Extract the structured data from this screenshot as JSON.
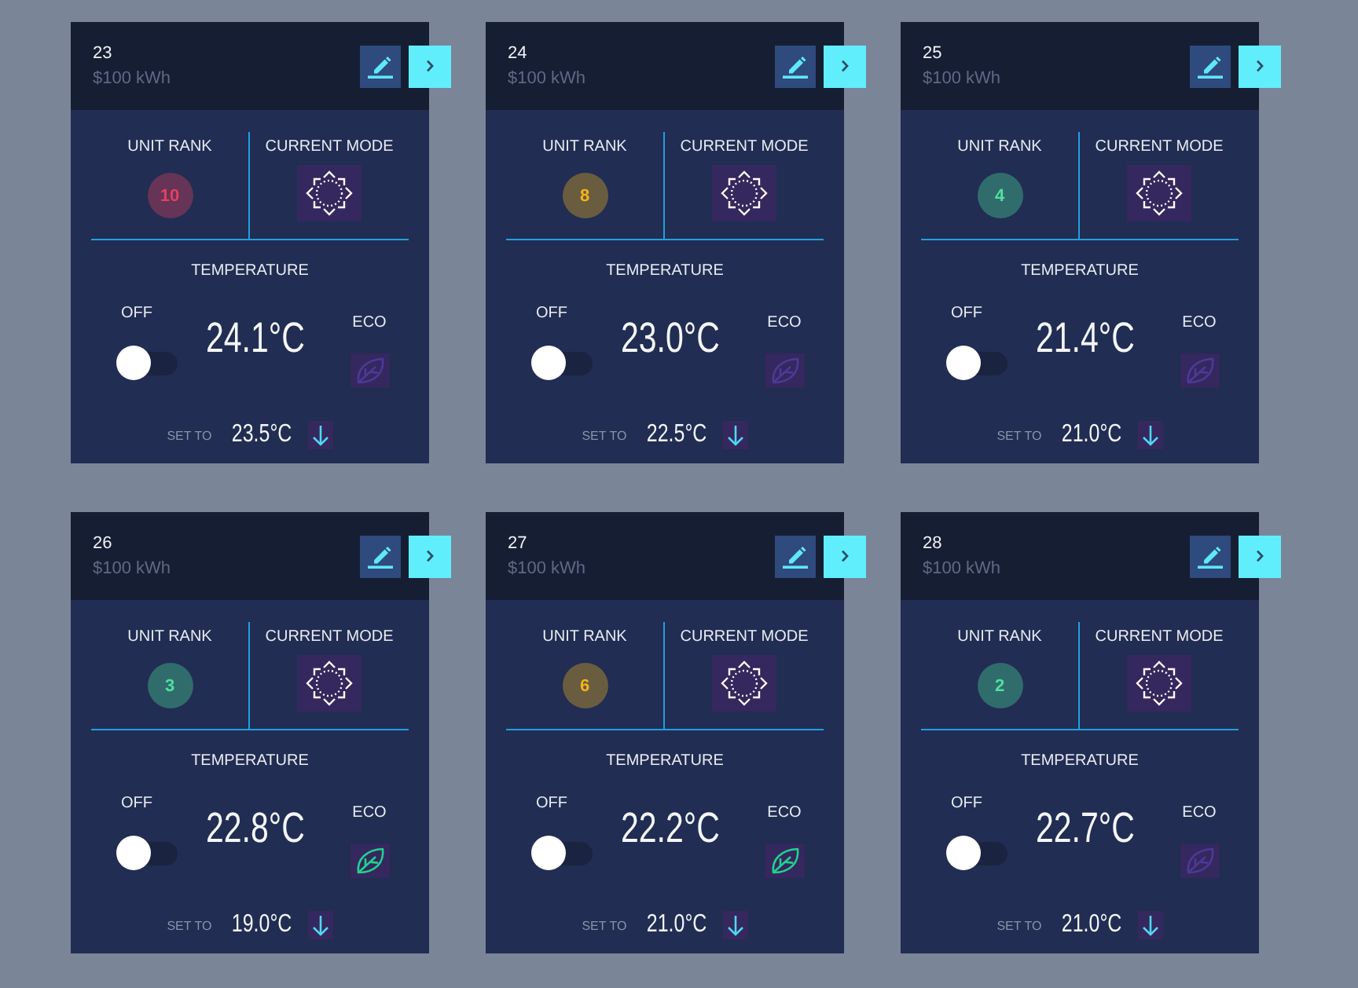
{
  "cards": [
    {
      "title": "23",
      "subtitle": "$100 kWh",
      "rank": {
        "label": "UNIT RANK",
        "value": "10",
        "color": "#e4405e"
      },
      "mode": {
        "label": "CURRENT MODE"
      },
      "temperature": {
        "label": "TEMPERATURE",
        "reading": "24.1°C"
      },
      "power": {
        "label": "OFF",
        "on": false
      },
      "eco": {
        "label": "ECO",
        "on": false
      },
      "setpoint": {
        "label": "SET TO",
        "value": "23.5°C"
      }
    },
    {
      "title": "24",
      "subtitle": "$100 kWh",
      "rank": {
        "label": "UNIT RANK",
        "value": "8",
        "color": "#f2b41c"
      },
      "mode": {
        "label": "CURRENT MODE"
      },
      "temperature": {
        "label": "TEMPERATURE",
        "reading": "23.0°C"
      },
      "power": {
        "label": "OFF",
        "on": false
      },
      "eco": {
        "label": "ECO",
        "on": false
      },
      "setpoint": {
        "label": "SET TO",
        "value": "22.5°C"
      }
    },
    {
      "title": "25",
      "subtitle": "$100 kWh",
      "rank": {
        "label": "UNIT RANK",
        "value": "4",
        "color": "#4fe0a0"
      },
      "mode": {
        "label": "CURRENT MODE"
      },
      "temperature": {
        "label": "TEMPERATURE",
        "reading": "21.4°C"
      },
      "power": {
        "label": "OFF",
        "on": false
      },
      "eco": {
        "label": "ECO",
        "on": false
      },
      "setpoint": {
        "label": "SET TO",
        "value": "21.0°C"
      }
    },
    {
      "title": "26",
      "subtitle": "$100 kWh",
      "rank": {
        "label": "UNIT RANK",
        "value": "3",
        "color": "#4fe0a0"
      },
      "mode": {
        "label": "CURRENT MODE"
      },
      "temperature": {
        "label": "TEMPERATURE",
        "reading": "22.8°C"
      },
      "power": {
        "label": "OFF",
        "on": false
      },
      "eco": {
        "label": "ECO",
        "on": true
      },
      "setpoint": {
        "label": "SET TO",
        "value": "19.0°C"
      }
    },
    {
      "title": "27",
      "subtitle": "$100 kWh",
      "rank": {
        "label": "UNIT RANK",
        "value": "6",
        "color": "#f2b41c"
      },
      "mode": {
        "label": "CURRENT MODE"
      },
      "temperature": {
        "label": "TEMPERATURE",
        "reading": "22.2°C"
      },
      "power": {
        "label": "OFF",
        "on": false
      },
      "eco": {
        "label": "ECO",
        "on": true
      },
      "setpoint": {
        "label": "SET TO",
        "value": "21.0°C"
      }
    },
    {
      "title": "28",
      "subtitle": "$100 kWh",
      "rank": {
        "label": "UNIT RANK",
        "value": "2",
        "color": "#4fe0a0"
      },
      "mode": {
        "label": "CURRENT MODE"
      },
      "temperature": {
        "label": "TEMPERATURE",
        "reading": "22.7°C"
      },
      "power": {
        "label": "OFF",
        "on": false
      },
      "eco": {
        "label": "ECO",
        "on": false
      },
      "setpoint": {
        "label": "SET TO",
        "value": "21.0°C"
      }
    }
  ]
}
